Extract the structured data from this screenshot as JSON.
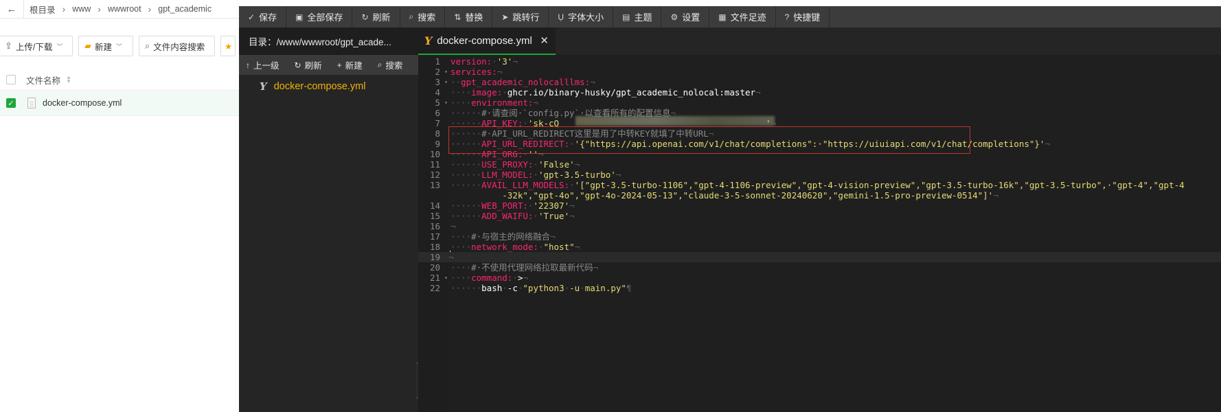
{
  "file_manager": {
    "breadcrumbs": [
      "根目录",
      "www",
      "wwwroot",
      "gpt_academic"
    ],
    "toolbar": {
      "upload_label": "上传/下载",
      "new_label": "新建",
      "search_label": "文件内容搜索"
    },
    "column_header": "文件名称",
    "files": [
      {
        "name": "docker-compose.yml",
        "checked": true
      }
    ]
  },
  "editor": {
    "menu": [
      {
        "icon": "save-icon",
        "glyph": "✓",
        "label": "保存"
      },
      {
        "icon": "save-all-icon",
        "glyph": "▣",
        "label": "全部保存"
      },
      {
        "icon": "refresh-icon",
        "glyph": "↻",
        "label": "刷新"
      },
      {
        "icon": "search-icon",
        "glyph": "⌕",
        "label": "搜索"
      },
      {
        "icon": "replace-icon",
        "glyph": "⇅",
        "label": "替换"
      },
      {
        "icon": "goto-line-icon",
        "glyph": "➤",
        "label": "跳转行"
      },
      {
        "icon": "font-size-icon",
        "glyph": "Ụ",
        "label": "字体大小"
      },
      {
        "icon": "theme-icon",
        "glyph": "▤",
        "label": "主题"
      },
      {
        "icon": "settings-icon",
        "glyph": "⚙",
        "label": "设置"
      },
      {
        "icon": "history-icon",
        "glyph": "▦",
        "label": "文件足迹"
      },
      {
        "icon": "help-icon",
        "glyph": "?",
        "label": "快捷键"
      }
    ],
    "directory": "目录：/www/wwwroot/gpt_acade...",
    "side_tools": {
      "up": "上一级",
      "refresh": "刷新",
      "new": "新建",
      "search": "搜索"
    },
    "tree_file": "docker-compose.yml",
    "tab_title": "docker-compose.yml",
    "code_lines": [
      {
        "n": "1",
        "fold": "",
        "indent": "",
        "parts": [
          [
            "k",
            "version:"
          ],
          [
            "w",
            "·"
          ],
          [
            "s",
            "'3'"
          ],
          [
            "w",
            "¬"
          ]
        ]
      },
      {
        "n": "2",
        "fold": "▾",
        "indent": "",
        "parts": [
          [
            "k",
            "services:"
          ],
          [
            "w",
            "¬"
          ]
        ]
      },
      {
        "n": "3",
        "fold": "▾",
        "indent": "··",
        "parts": [
          [
            "k",
            "gpt_academic_nolocalllms:"
          ],
          [
            "w",
            "¬"
          ]
        ]
      },
      {
        "n": "4",
        "fold": "",
        "indent": "····",
        "parts": [
          [
            "k",
            "image:"
          ],
          [
            "w",
            "·"
          ],
          [
            "v",
            "ghcr.io/binary-husky/gpt_academic_nolocal:master"
          ],
          [
            "w",
            "¬"
          ]
        ]
      },
      {
        "n": "5",
        "fold": "▾",
        "indent": "····",
        "parts": [
          [
            "k",
            "environment:"
          ],
          [
            "w",
            "¬"
          ]
        ]
      },
      {
        "n": "6",
        "fold": "",
        "indent": "······",
        "parts": [
          [
            "c",
            "#·请查阅·`config.py`·以查看所有的配置信息"
          ],
          [
            "w",
            "¬"
          ]
        ]
      },
      {
        "n": "7",
        "fold": "",
        "indent": "······",
        "parts": [
          [
            "k",
            "API_KEY:"
          ],
          [
            "w",
            "·"
          ],
          [
            "s",
            "'sk-cQ"
          ],
          [
            "s",
            "                                        "
          ],
          [
            "s",
            "'"
          ],
          [
            "w",
            "¬"
          ]
        ]
      },
      {
        "n": "8",
        "fold": "",
        "indent": "······",
        "parts": [
          [
            "c",
            "#·API_URL_REDIRECT这里是用了中转KEY就填了中转URL"
          ],
          [
            "w",
            "¬"
          ]
        ]
      },
      {
        "n": "9",
        "fold": "",
        "indent": "······",
        "parts": [
          [
            "k",
            "API_URL_REDIRECT:"
          ],
          [
            "w",
            "·"
          ],
          [
            "s",
            "'{\"https://api.openai.com/v1/chat/completions\":·\"https://uiuiapi.com/v1/chat/completions\"}'"
          ],
          [
            "w",
            "¬"
          ]
        ]
      },
      {
        "n": "10",
        "fold": "",
        "indent": "······",
        "parts": [
          [
            "k",
            "API_ORG:"
          ],
          [
            "w",
            "·"
          ],
          [
            "s",
            "''"
          ],
          [
            "w",
            "¬"
          ]
        ]
      },
      {
        "n": "11",
        "fold": "",
        "indent": "······",
        "parts": [
          [
            "k",
            "USE_PROXY:"
          ],
          [
            "w",
            "·"
          ],
          [
            "s",
            "'False'"
          ],
          [
            "w",
            "¬"
          ]
        ]
      },
      {
        "n": "12",
        "fold": "",
        "indent": "······",
        "parts": [
          [
            "k",
            "LLM_MODEL:"
          ],
          [
            "w",
            "·"
          ],
          [
            "s",
            "'gpt-3.5-turbo'"
          ],
          [
            "w",
            "¬"
          ]
        ]
      },
      {
        "n": "13",
        "fold": "",
        "indent": "······",
        "parts": [
          [
            "k",
            "AVAIL_LLM_MODELS:"
          ],
          [
            "w",
            "·"
          ],
          [
            "s",
            "'[\"gpt-3.5-turbo-1106\",\"gpt-4-1106-preview\",\"gpt-4-vision-preview\",\"gpt-3.5-turbo-16k\",\"gpt-3.5-turbo\",·\"gpt-4\",\"gpt-4"
          ]
        ]
      },
      {
        "n": "",
        "fold": "",
        "indent": "          ",
        "parts": [
          [
            "s",
            "-32k\",\"gpt-4o\",\"gpt-4o-2024-05-13\",\"claude-3-5-sonnet-20240620\",\"gemini-1.5-pro-preview-0514\"]'"
          ],
          [
            "w",
            "¬"
          ]
        ]
      },
      {
        "n": "14",
        "fold": "",
        "indent": "······",
        "parts": [
          [
            "k",
            "WEB_PORT:"
          ],
          [
            "w",
            "·"
          ],
          [
            "s",
            "'22307'"
          ],
          [
            "w",
            "¬"
          ]
        ]
      },
      {
        "n": "15",
        "fold": "",
        "indent": "······",
        "parts": [
          [
            "k",
            "ADD_WAIFU:"
          ],
          [
            "w",
            "·"
          ],
          [
            "s",
            "'True'"
          ],
          [
            "w",
            "¬"
          ]
        ]
      },
      {
        "n": "16",
        "fold": "",
        "indent": "",
        "parts": [
          [
            "w",
            "¬"
          ]
        ]
      },
      {
        "n": "17",
        "fold": "",
        "indent": "····",
        "parts": [
          [
            "c",
            "#·与宿主的网络融合"
          ],
          [
            "w",
            "¬"
          ]
        ]
      },
      {
        "n": "18",
        "fold": "",
        "indent": "····",
        "parts": [
          [
            "k",
            "network_mode:"
          ],
          [
            "w",
            "·"
          ],
          [
            "s",
            "\"host\""
          ],
          [
            "w",
            "¬"
          ]
        ]
      },
      {
        "n": "19",
        "fold": "",
        "indent": "",
        "parts": [
          [
            "w",
            "¬"
          ]
        ],
        "active": true
      },
      {
        "n": "20",
        "fold": "",
        "indent": "····",
        "parts": [
          [
            "c",
            "#·不使用代理网络拉取最新代码"
          ],
          [
            "w",
            "¬"
          ]
        ]
      },
      {
        "n": "21",
        "fold": "▾",
        "indent": "····",
        "parts": [
          [
            "k",
            "command:"
          ],
          [
            "w",
            "·"
          ],
          [
            "v",
            ">"
          ],
          [
            "w",
            "¬"
          ]
        ]
      },
      {
        "n": "22",
        "fold": "",
        "indent": "······",
        "parts": [
          [
            "v",
            "bash"
          ],
          [
            "w",
            "·"
          ],
          [
            "v",
            "-c"
          ],
          [
            "w",
            "·"
          ],
          [
            "s",
            "\"python3"
          ],
          [
            "w",
            "·"
          ],
          [
            "s",
            "-u"
          ],
          [
            "w",
            "·"
          ],
          [
            "s",
            "main.py\""
          ],
          [
            "w",
            "¶"
          ]
        ]
      }
    ]
  }
}
